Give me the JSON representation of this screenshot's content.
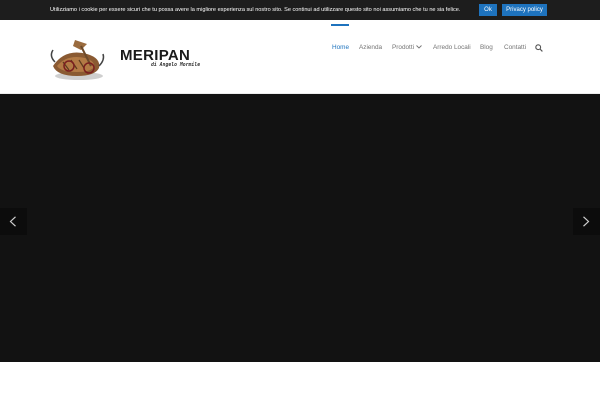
{
  "cookie_bar": {
    "message": "Utilizziamo i cookie per essere sicuri che tu possa avere la migliore esperienza sul nostro sito. Se continui ad utilizzare questo sito noi assumiamo che tu ne sia felice.",
    "ok_label": "Ok",
    "privacy_label": "Privacy policy"
  },
  "brand": {
    "name": "MERIPAN",
    "tagline": "di Angelo Mormile"
  },
  "nav": {
    "items": [
      {
        "label": "Home",
        "active": true
      },
      {
        "label": "Azienda"
      },
      {
        "label": "Prodotti",
        "has_dropdown": true
      },
      {
        "label": "Arredo Locali"
      },
      {
        "label": "Blog"
      },
      {
        "label": "Contatti"
      }
    ],
    "search_icon": "search-icon"
  },
  "colors": {
    "accent": "#1e73be",
    "cookie_bar_bg": "#1d1d1d",
    "slider_bg": "#121212",
    "nav_text": "#747474"
  },
  "icons": {
    "logo": "bread-logo-icon",
    "prev": "chevron-left-icon",
    "next": "chevron-right-icon",
    "dropdown": "chevron-down-icon"
  }
}
